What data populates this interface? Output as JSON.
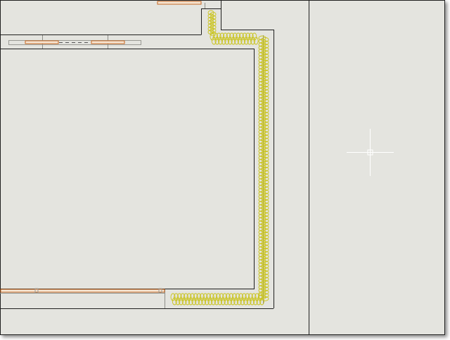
{
  "viewport": {
    "background": "#e4e4df"
  },
  "colors": {
    "wall": "#1f1f1f",
    "insulation": "#c9c31a",
    "door_outline": "#c5651f",
    "door_fill": "#f6e7d6",
    "cursor": "#ffffff"
  },
  "icons": {
    "crosshair": "crosshair-cursor-icon"
  }
}
